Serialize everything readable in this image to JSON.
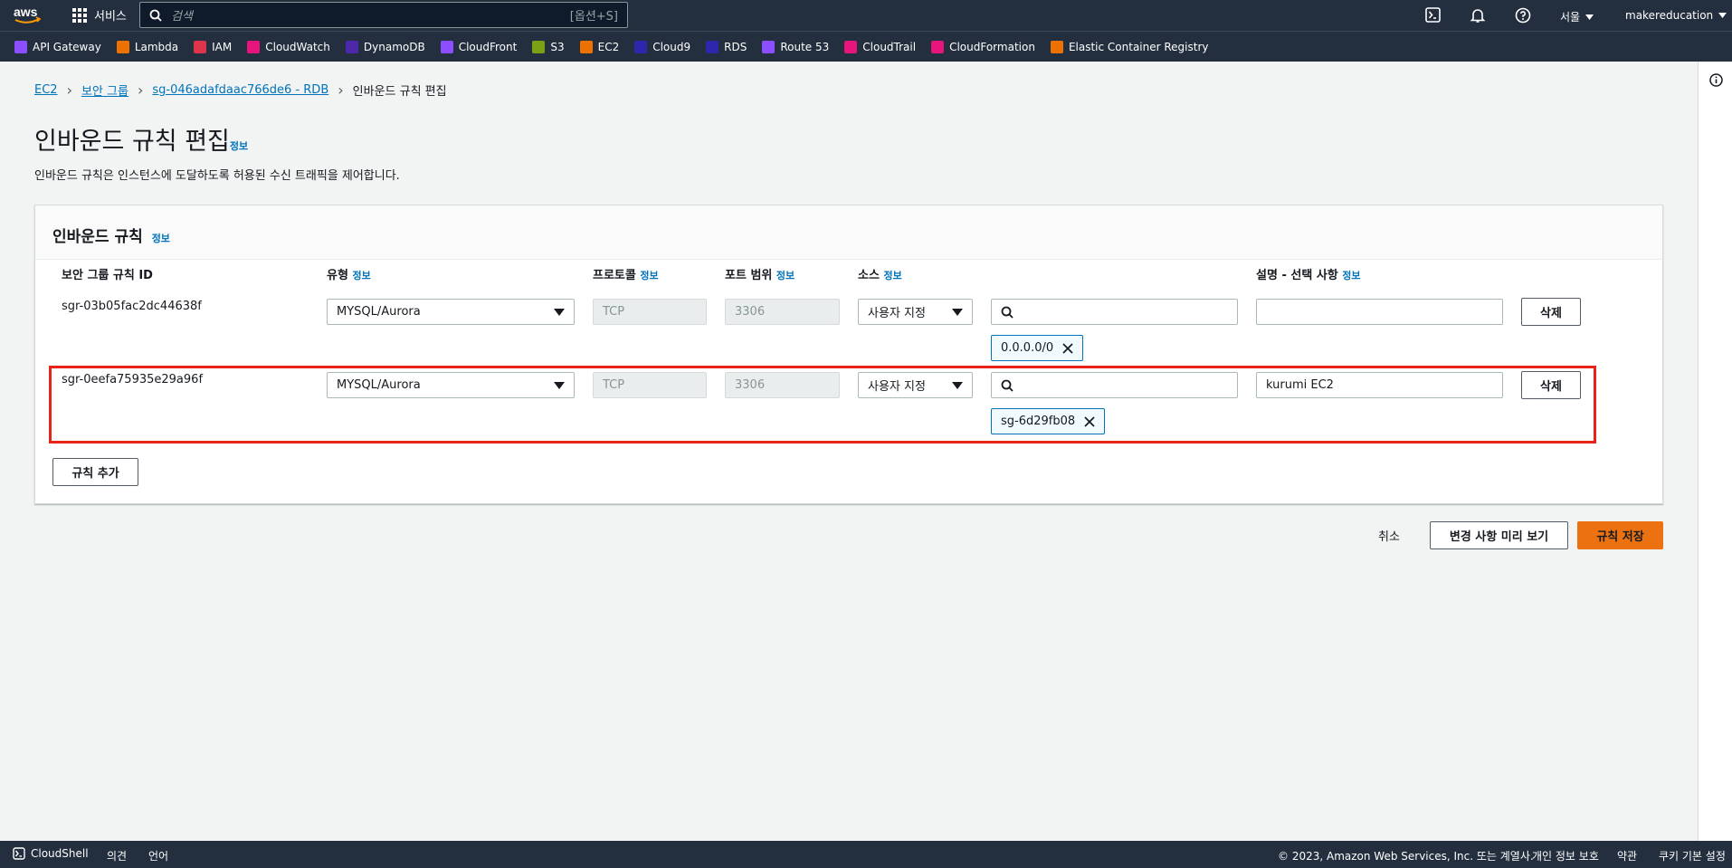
{
  "topnav": {
    "services_label": "서비스",
    "search_placeholder": "검색",
    "search_shortcut": "[옵션+S]",
    "region": "서울",
    "account": "makereducation"
  },
  "favorites": [
    {
      "label": "API Gateway",
      "color": "#8c4fff"
    },
    {
      "label": "Lambda",
      "color": "#ed7100"
    },
    {
      "label": "IAM",
      "color": "#dd344c"
    },
    {
      "label": "CloudWatch",
      "color": "#e7157b"
    },
    {
      "label": "DynamoDB",
      "color": "#4d27aa"
    },
    {
      "label": "CloudFront",
      "color": "#8c4fff"
    },
    {
      "label": "S3",
      "color": "#7aa116"
    },
    {
      "label": "EC2",
      "color": "#ed7100"
    },
    {
      "label": "Cloud9",
      "color": "#2e27ad"
    },
    {
      "label": "RDS",
      "color": "#2e27ad"
    },
    {
      "label": "Route 53",
      "color": "#8c4fff"
    },
    {
      "label": "CloudTrail",
      "color": "#e7157b"
    },
    {
      "label": "CloudFormation",
      "color": "#e7157b"
    },
    {
      "label": "Elastic Container Registry",
      "color": "#ed7100"
    }
  ],
  "breadcrumb": {
    "c1": "EC2",
    "c2": "보안 그룹",
    "c3": "sg-046adafdaac766de6 - RDB",
    "c4": "인바운드 규칙 편집"
  },
  "page": {
    "title": "인바운드 규칙 편집",
    "info": "정보",
    "description": "인바운드 규칙은 인스턴스에 도달하도록 허용된 수신 트래픽을 제어합니다."
  },
  "panel": {
    "title": "인바운드 규칙",
    "info": "정보"
  },
  "columns": {
    "rule_id": "보안 그룹 규칙 ID",
    "type": "유형",
    "protocol": "프로토콜",
    "port": "포트 범위",
    "source": "소스",
    "desc": "설명 - 선택 사항",
    "info": "정보"
  },
  "rows": [
    {
      "id": "sgr-03b05fac2dc44638f",
      "type": "MYSQL/Aurora",
      "protocol": "TCP",
      "port": "3306",
      "source": "사용자 지정",
      "search": "",
      "token": "0.0.0.0/0",
      "desc": "",
      "delete": "삭제"
    },
    {
      "id": "sgr-0eefa75935e29a96f",
      "type": "MYSQL/Aurora",
      "protocol": "TCP",
      "port": "3306",
      "source": "사용자 지정",
      "search": "",
      "token": "sg-6d29fb08",
      "desc": "kurumi EC2",
      "delete": "삭제"
    }
  ],
  "add_rule": "규칙 추가",
  "actions": {
    "cancel": "취소",
    "preview": "변경 사항 미리 보기",
    "save": "규칙 저장"
  },
  "footer": {
    "cloudshell": "CloudShell",
    "feedback": "의견",
    "language": "언어",
    "copyright": "© 2023, Amazon Web Services, Inc. 또는 계열사.",
    "privacy": "개인 정보 보호",
    "terms": "약관",
    "cookies": "쿠키 기본 설정"
  }
}
